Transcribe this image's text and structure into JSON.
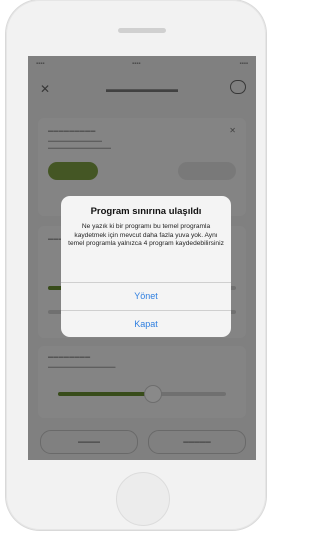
{
  "alert": {
    "title": "Program sınırına ulaşıldı",
    "message": "Ne yazık ki bir programı bu temel programla kaydetmek için mevcut daha fazla yuva yok. Aynı temel programla yalnızca 4 program kaydedebilirsiniz",
    "actions": [
      "Yönet",
      "Kapat"
    ]
  },
  "colors": {
    "link": "#2f7fe0",
    "dim_overlay": "rgba(0,0,0,0.38)",
    "accent_green": "#5b7b2a"
  },
  "icons": {
    "back": "close-icon",
    "help": "chat-icon"
  }
}
